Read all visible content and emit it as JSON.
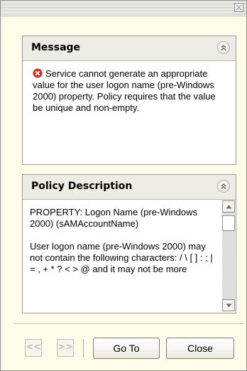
{
  "titlebar": {
    "close_icon": "close-icon"
  },
  "message": {
    "title": "Message",
    "icon": "error-icon",
    "text": "Service cannot generate an appropriate value for the user logon name (pre-Windows 2000) property. Policy requires that the value be unique and non-empty."
  },
  "policy": {
    "title": "Policy Description",
    "paragraphs": [
      "PROPERTY: Logon Name (pre-Windows 2000) (sAMAccountName)",
      "User logon name (pre-Windows 2000) may not contain the following characters: / \\ [ ] : ; | = , + * ? < > @ and it may not be more"
    ]
  },
  "footer": {
    "prev_label": "<<",
    "next_label": ">>",
    "goto_label": "Go To",
    "close_label": "Close"
  },
  "colors": {
    "window_bg": "#fdfce8",
    "header_bg": "#ecebe4",
    "error_red": "#d62b1e"
  }
}
